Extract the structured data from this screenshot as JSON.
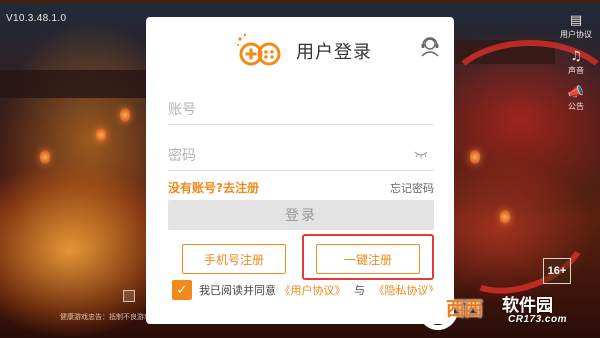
{
  "version": "V10.3.48.1.0",
  "side_menu": [
    {
      "icon": "user-agreement-icon",
      "label": "用户协议"
    },
    {
      "icon": "sound-icon",
      "label": "声音"
    },
    {
      "icon": "announcement-icon",
      "label": "公告"
    }
  ],
  "age_rating": "16+",
  "health_tip": "健康游戏忠告：抵制不良游戏，拒绝盗版游戏",
  "dialog": {
    "title": "用户登录",
    "account_placeholder": "账号",
    "password_placeholder": "密码",
    "no_account_link": "没有账号?去注册",
    "forgot_password": "忘记密码",
    "login_button": "登录",
    "phone_register": "手机号注册",
    "quick_register": "一键注册",
    "agree_checked": true,
    "agree_prefix": "我已阅读并同意",
    "user_agreement": "《用户协议》",
    "agree_and": "与",
    "privacy_agreement": "《隐私协议》"
  },
  "watermark": {
    "brand": "西西",
    "name": "软件园",
    "url": "CR173.com"
  },
  "colors": {
    "accent": "#f08a1a",
    "highlight": "#e03a3a",
    "disabled_button": "#e3e3e3"
  }
}
